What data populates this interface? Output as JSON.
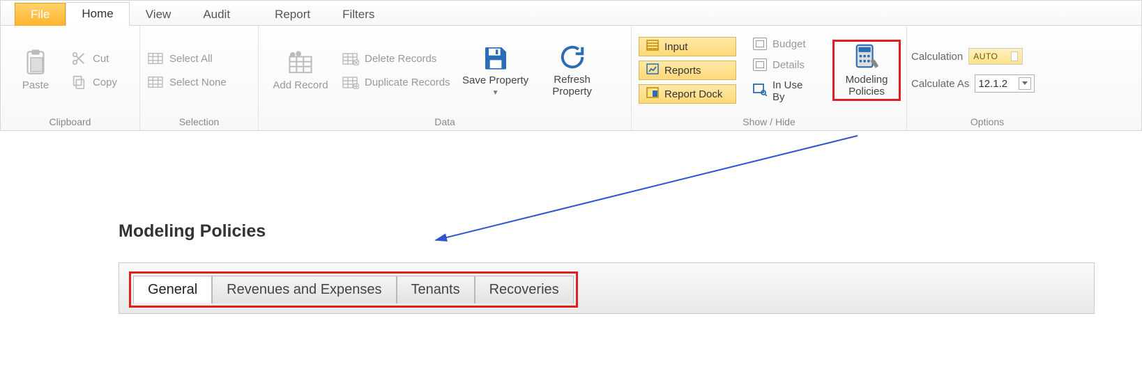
{
  "ribbon": {
    "tabs": {
      "file": "File",
      "home": "Home",
      "view": "View",
      "audit": "Audit",
      "report": "Report",
      "filters": "Filters"
    },
    "clipboard": {
      "paste": "Paste",
      "cut": "Cut",
      "copy": "Copy",
      "group": "Clipboard"
    },
    "selection": {
      "selectAll": "Select All",
      "selectNone": "Select None",
      "group": "Selection"
    },
    "data": {
      "addRecord": "Add Record",
      "deleteRecords": "Delete Records",
      "duplicateRecords": "Duplicate Records",
      "saveProperty": "Save Property",
      "refreshProperty": "Refresh Property",
      "group": "Data"
    },
    "showHide": {
      "input": "Input",
      "reports": "Reports",
      "reportDock": "Report Dock",
      "budget": "Budget",
      "details": "Details",
      "inUseBy": "In Use By",
      "modelingPolicies": "Modeling Policies",
      "modelingLine2": "Policies",
      "modelingLine1": "Modeling",
      "group": "Show / Hide"
    },
    "options": {
      "calculation": "Calculation",
      "calcMode": "AUTO",
      "calculateAs": "Calculate As",
      "calcVersion": "12.1.2",
      "group": "Options"
    }
  },
  "page": {
    "title": "Modeling Policies",
    "tabs": [
      "General",
      "Revenues and Expenses",
      "Tenants",
      "Recoveries"
    ]
  }
}
